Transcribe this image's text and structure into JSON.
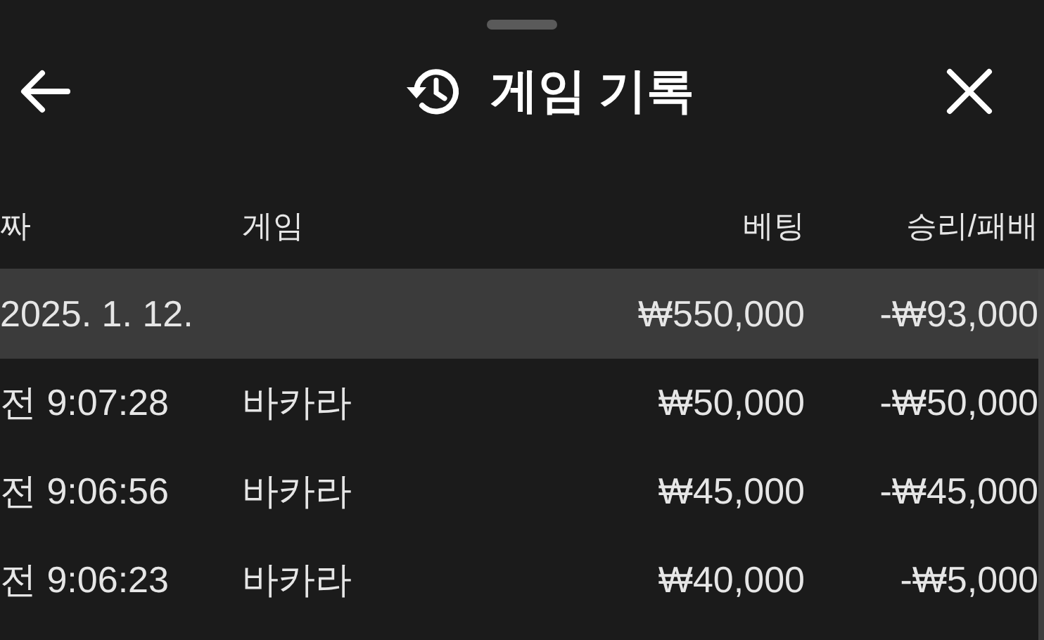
{
  "header": {
    "title": "게임 기록"
  },
  "table": {
    "columns": [
      "짜",
      "게임",
      "베팅",
      "승리/패배"
    ],
    "rows": [
      {
        "kind": "group",
        "date": "2025. 1. 12.",
        "bet": "₩550,000",
        "result": "-₩93,000"
      },
      {
        "kind": "entry",
        "time": "전 9:07:28",
        "game": "바카라",
        "bet": "₩50,000",
        "result": "-₩50,000"
      },
      {
        "kind": "entry",
        "time": "전 9:06:56",
        "game": "바카라",
        "bet": "₩45,000",
        "result": "-₩45,000"
      },
      {
        "kind": "entry",
        "time": "전 9:06:23",
        "game": "바카라",
        "bet": "₩40,000",
        "result": "-₩5,000"
      }
    ]
  }
}
